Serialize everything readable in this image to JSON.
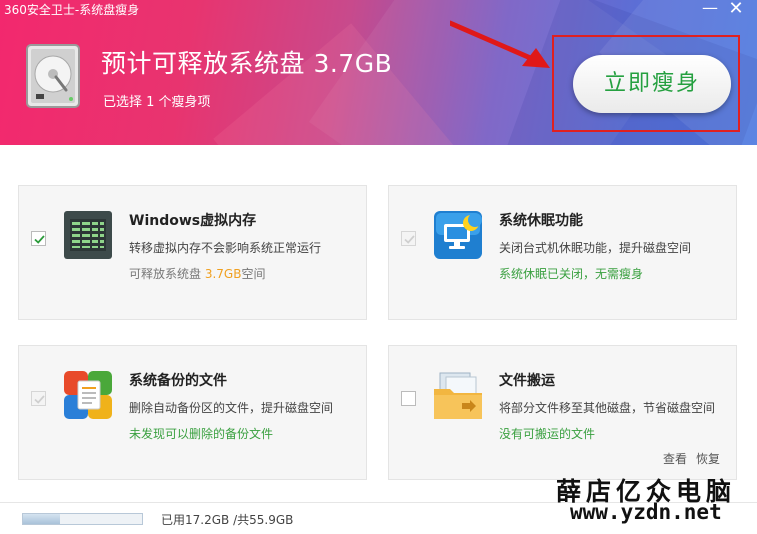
{
  "window": {
    "title": "360安全卫士-系统盘瘦身",
    "minimize_glyph": "—",
    "close_glyph": "✕"
  },
  "header": {
    "title": "预计可释放系统盘 3.7GB",
    "subtitle": "已选择 1 个瘦身项",
    "action_button": "立即瘦身",
    "icon": "hard-drive-icon",
    "colors": {
      "gradient_start": "#f3286e",
      "gradient_end": "#4f7be0",
      "button_text": "#25a040",
      "highlight": "#e02020"
    }
  },
  "cards": [
    {
      "title": "Windows虚拟内存",
      "desc": "转移虚拟内存不会影响系统正常运行",
      "info_prefix": "可释放系统盘 ",
      "info_value": "3.7GB",
      "info_suffix": "空间",
      "icon": "virtual-memory-icon",
      "checked": true,
      "enabled": true
    },
    {
      "title": "系统休眠功能",
      "desc": "关闭台式机休眠功能，提升磁盘空间",
      "info": "系统休眠已关闭，无需瘦身",
      "icon": "hibernate-icon",
      "checked": true,
      "enabled": false
    },
    {
      "title": "系统备份的文件",
      "desc": "删除自动备份区的文件，提升磁盘空间",
      "info": "未发现可以删除的备份文件",
      "icon": "backup-files-icon",
      "checked": true,
      "enabled": false
    },
    {
      "title": "文件搬运",
      "desc": "将部分文件移至其他磁盘，节省磁盘空间",
      "info": "没有可搬运的文件",
      "icon": "file-move-icon",
      "checked": false,
      "enabled": true
    }
  ],
  "links": {
    "view": "查看",
    "restore": "恢复"
  },
  "footer": {
    "usage": "已用17.2GB /共55.9GB",
    "disk_usage_fraction": 0.31
  },
  "watermark": {
    "line1": "薛店亿众电脑",
    "line2": "www.yzdn.net"
  }
}
